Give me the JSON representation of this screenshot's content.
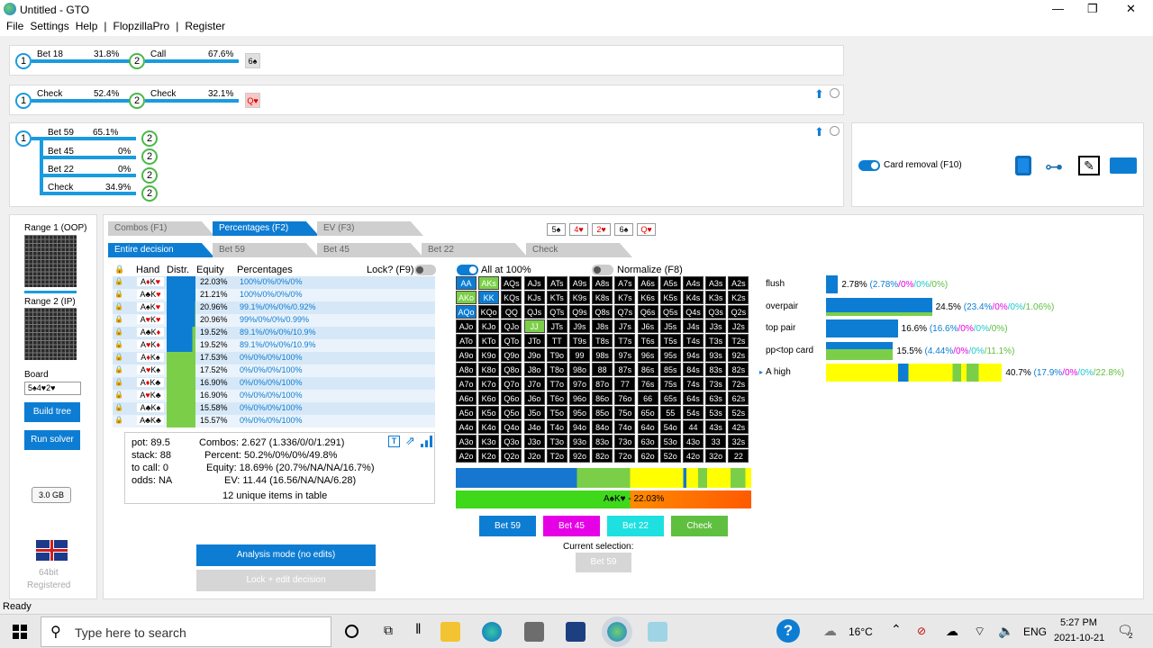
{
  "window": {
    "title": "Untitled - GTO",
    "min": "—",
    "max": "❐",
    "close": "✕"
  },
  "menu": [
    "File",
    "Settings",
    "Help",
    "|",
    "FlopzillaPro",
    "|",
    "Register"
  ],
  "tree": [
    {
      "a": "Bet 18",
      "ap": "31.8%",
      "b": "Call",
      "bp": "67.6%",
      "card": "6♠"
    },
    {
      "a": "Check",
      "ap": "52.4%",
      "b": "Check",
      "bp": "32.1%",
      "card": "Q♥"
    }
  ],
  "node_one": "1",
  "node_two": "2",
  "branches": [
    {
      "l": "Bet 59",
      "p": "65.1%"
    },
    {
      "l": "Bet 45",
      "p": "0%"
    },
    {
      "l": "Bet 22",
      "p": "0%"
    },
    {
      "l": "Check",
      "p": "34.9%"
    }
  ],
  "card_removal": "Card removal (F10)",
  "left": {
    "range1": "Range 1 (OOP)",
    "range2": "Range 2 (IP)",
    "board_lbl": "Board",
    "board": "5♠4♥2♥",
    "build": "Build tree",
    "run": "Run solver",
    "mem": "3.0 GB",
    "bits": "64bit",
    "reg": "Registered"
  },
  "tabs_top": [
    "Combos (F1)",
    "Percentages (F2)",
    "EV (F3)"
  ],
  "board_cards": [
    "5♠",
    "4♥",
    "2♥",
    "6♠",
    "Q♥"
  ],
  "tabs_sub": [
    "Entire decision",
    "Bet 59",
    "Bet 45",
    "Bet 22",
    "Check"
  ],
  "table": {
    "h_hand": "Hand",
    "h_distr": "Distr.",
    "h_eq": "Equity",
    "h_pct": "Percentages",
    "lock": "Lock? (F9)",
    "rows": [
      [
        "A♦K♥",
        "22.03%",
        "100%/0%/0%/0%"
      ],
      [
        "A♣K♥",
        "21.21%",
        "100%/0%/0%/0%"
      ],
      [
        "A♠K♥",
        "20.96%",
        "99.1%/0%/0%/0.92%"
      ],
      [
        "A♥K♥",
        "20.96%",
        "99%/0%/0%/0.99%"
      ],
      [
        "A♣K♦",
        "19.52%",
        "89.1%/0%/0%/10.9%"
      ],
      [
        "A♥K♦",
        "19.52%",
        "89.1%/0%/0%/10.9%"
      ],
      [
        "A♦K♠",
        "17.53%",
        "0%/0%/0%/100%"
      ],
      [
        "A♥K♠",
        "17.52%",
        "0%/0%/0%/100%"
      ],
      [
        "A♦K♣",
        "16.90%",
        "0%/0%/0%/100%"
      ],
      [
        "A♥K♣",
        "16.90%",
        "0%/0%/0%/100%"
      ],
      [
        "A♣K♠",
        "15.58%",
        "0%/0%/0%/100%"
      ],
      [
        "A♣K♣",
        "15.57%",
        "0%/0%/0%/100%"
      ]
    ]
  },
  "stats": {
    "pot": "pot: 89.5",
    "stack": "stack: 88",
    "tocall": "to call: 0",
    "odds": "odds: NA",
    "combos": "Combos: 2.627 (1.336/0/0/1.291)",
    "percent": "Percent: 50.2%/0%/0%/49.8%",
    "equity": "Equity: 18.69% (20.7%/NA/NA/16.7%)",
    "ev": "EV: 11.44 (16.56/NA/NA/6.28)",
    "unique": "12 unique items in table"
  },
  "all100": "All at 100%",
  "normalize": "Normalize (F8)",
  "grid": [
    [
      "AA",
      "AKs",
      "AQs",
      "AJs",
      "ATs",
      "A9s",
      "A8s",
      "A7s",
      "A6s",
      "A5s",
      "A4s",
      "A3s",
      "A2s"
    ],
    [
      "AKo",
      "KK",
      "KQs",
      "KJs",
      "KTs",
      "K9s",
      "K8s",
      "K7s",
      "K6s",
      "K5s",
      "K4s",
      "K3s",
      "K2s"
    ],
    [
      "AQo",
      "KQo",
      "QQ",
      "QJs",
      "QTs",
      "Q9s",
      "Q8s",
      "Q7s",
      "Q6s",
      "Q5s",
      "Q4s",
      "Q3s",
      "Q2s"
    ],
    [
      "AJo",
      "KJo",
      "QJo",
      "JJ",
      "JTs",
      "J9s",
      "J8s",
      "J7s",
      "J6s",
      "J5s",
      "J4s",
      "J3s",
      "J2s"
    ],
    [
      "ATo",
      "KTo",
      "QTo",
      "JTo",
      "TT",
      "T9s",
      "T8s",
      "T7s",
      "T6s",
      "T5s",
      "T4s",
      "T3s",
      "T2s"
    ],
    [
      "A9o",
      "K9o",
      "Q9o",
      "J9o",
      "T9o",
      "99",
      "98s",
      "97s",
      "96s",
      "95s",
      "94s",
      "93s",
      "92s"
    ],
    [
      "A8o",
      "K8o",
      "Q8o",
      "J8o",
      "T8o",
      "98o",
      "88",
      "87s",
      "86s",
      "85s",
      "84s",
      "83s",
      "82s"
    ],
    [
      "A7o",
      "K7o",
      "Q7o",
      "J7o",
      "T7o",
      "97o",
      "87o",
      "77",
      "76s",
      "75s",
      "74s",
      "73s",
      "72s"
    ],
    [
      "A6o",
      "K6o",
      "Q6o",
      "J6o",
      "T6o",
      "96o",
      "86o",
      "76o",
      "66",
      "65s",
      "64s",
      "63s",
      "62s"
    ],
    [
      "A5o",
      "K5o",
      "Q5o",
      "J5o",
      "T5o",
      "95o",
      "85o",
      "75o",
      "65o",
      "55",
      "54s",
      "53s",
      "52s"
    ],
    [
      "A4o",
      "K4o",
      "Q4o",
      "J4o",
      "T4o",
      "94o",
      "84o",
      "74o",
      "64o",
      "54o",
      "44",
      "43s",
      "42s"
    ],
    [
      "A3o",
      "K3o",
      "Q3o",
      "J3o",
      "T3o",
      "93o",
      "83o",
      "73o",
      "63o",
      "53o",
      "43o",
      "33",
      "32s"
    ],
    [
      "A2o",
      "K2o",
      "Q2o",
      "J2o",
      "T2o",
      "92o",
      "82o",
      "72o",
      "62o",
      "52o",
      "42o",
      "32o",
      "22"
    ]
  ],
  "hand_equity": "A♠K♥ - 22.03%",
  "actions": [
    {
      "l": "Bet 59",
      "c": "#0d7dd3"
    },
    {
      "l": "Bet 45",
      "c": "#e600e6"
    },
    {
      "l": "Bet 22",
      "c": "#1ee0e0"
    },
    {
      "l": "Check",
      "c": "#5fbf3f"
    }
  ],
  "current_sel": "Current selection:",
  "current_val": "Bet 59",
  "analysis": "Analysis mode (no edits)",
  "lockedit": "Lock + edit decision",
  "report": [
    {
      "name": "flush",
      "val": "2.78%",
      "det": [
        "(2.78%",
        "/0%",
        "/0%",
        "/0%)"
      ],
      "frac": 0.0278
    },
    {
      "name": "overpair",
      "val": "24.5%",
      "det": [
        "(23.4%",
        "/0%",
        "/0%",
        "/1.06%)"
      ],
      "frac": 0.245
    },
    {
      "name": "top pair",
      "val": "16.6%",
      "det": [
        "(16.6%",
        "/0%",
        "/0%",
        "/0%)"
      ],
      "frac": 0.166
    },
    {
      "name": "pp<top card",
      "val": "15.5%",
      "det": [
        "(4.44%",
        "/0%",
        "/0%",
        "/11.1%)"
      ],
      "frac": 0.155
    },
    {
      "name": "A high",
      "val": "40.7%",
      "det": [
        "(17.9%",
        "/0%",
        "/0%",
        "/22.8%)"
      ],
      "frac": 0.407
    }
  ],
  "status": "Ready",
  "taskbar": {
    "search": "Type here to search",
    "weather": "16°C",
    "lang": "ENG",
    "time": "5:27 PM",
    "date": "2021-10-21",
    "notif": "2"
  }
}
